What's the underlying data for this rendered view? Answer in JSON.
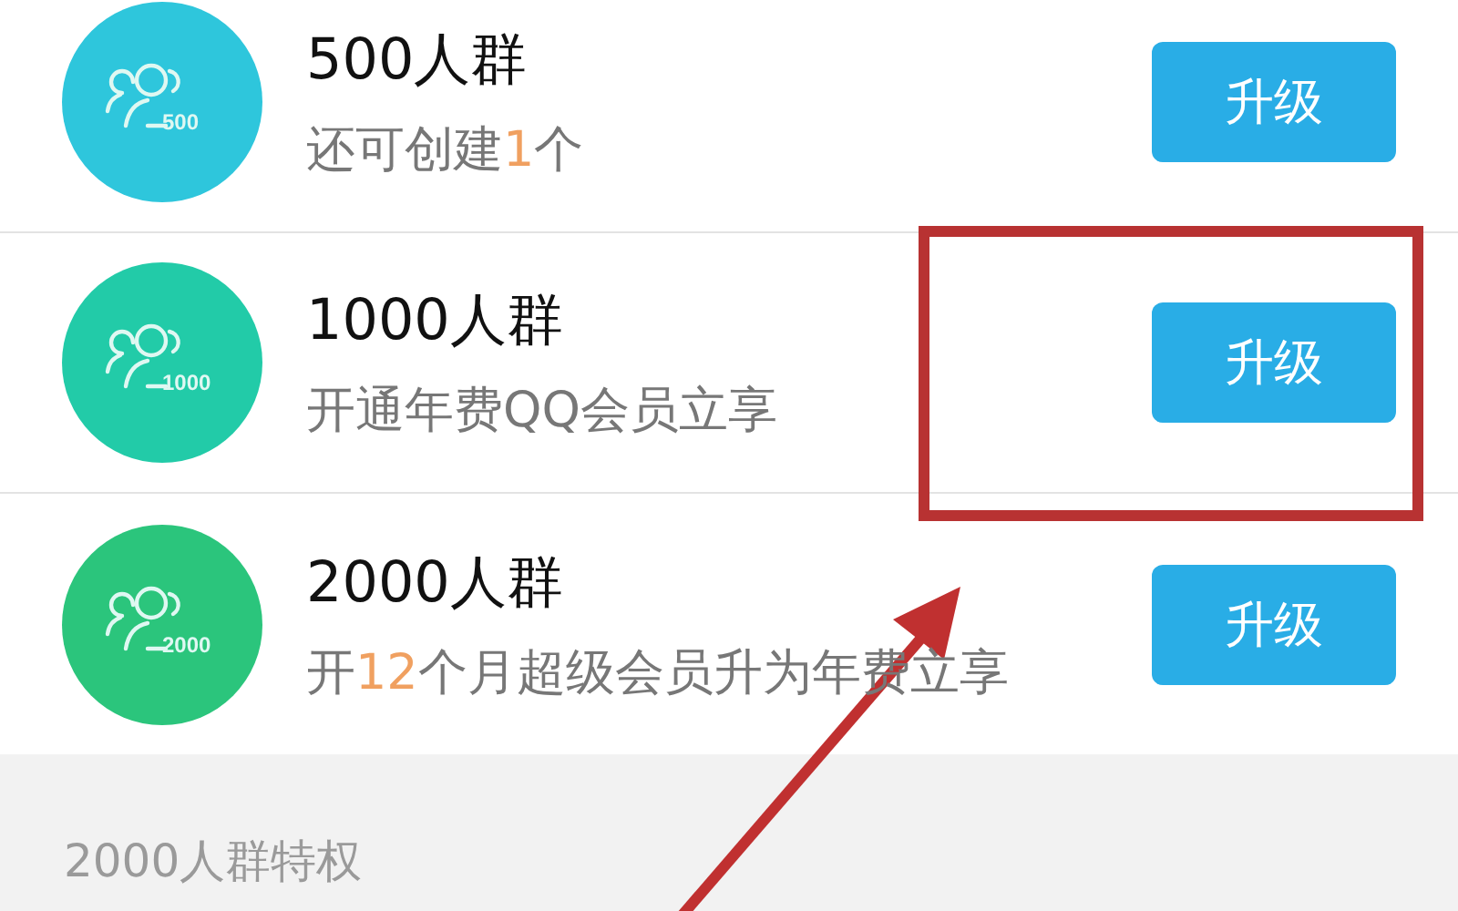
{
  "groups": [
    {
      "title": "500人群",
      "badge": "500",
      "color": "#2ec6dc",
      "subtitle": [
        {
          "text": "还可创建",
          "highlight": false
        },
        {
          "text": "1",
          "highlight": true
        },
        {
          "text": "个",
          "highlight": false
        }
      ],
      "button": "升级"
    },
    {
      "title": "1000人群",
      "badge": "1000",
      "color": "#22cba8",
      "subtitle": [
        {
          "text": "开通年费QQ会员立享",
          "highlight": false
        }
      ],
      "button": "升级"
    },
    {
      "title": "2000人群",
      "badge": "2000",
      "color": "#2bc57c",
      "subtitle": [
        {
          "text": "开",
          "highlight": false
        },
        {
          "text": "12",
          "highlight": true
        },
        {
          "text": "个月超级会员升为年费立享",
          "highlight": false
        }
      ],
      "button": "升级"
    }
  ],
  "section_header": "2000人群特权"
}
